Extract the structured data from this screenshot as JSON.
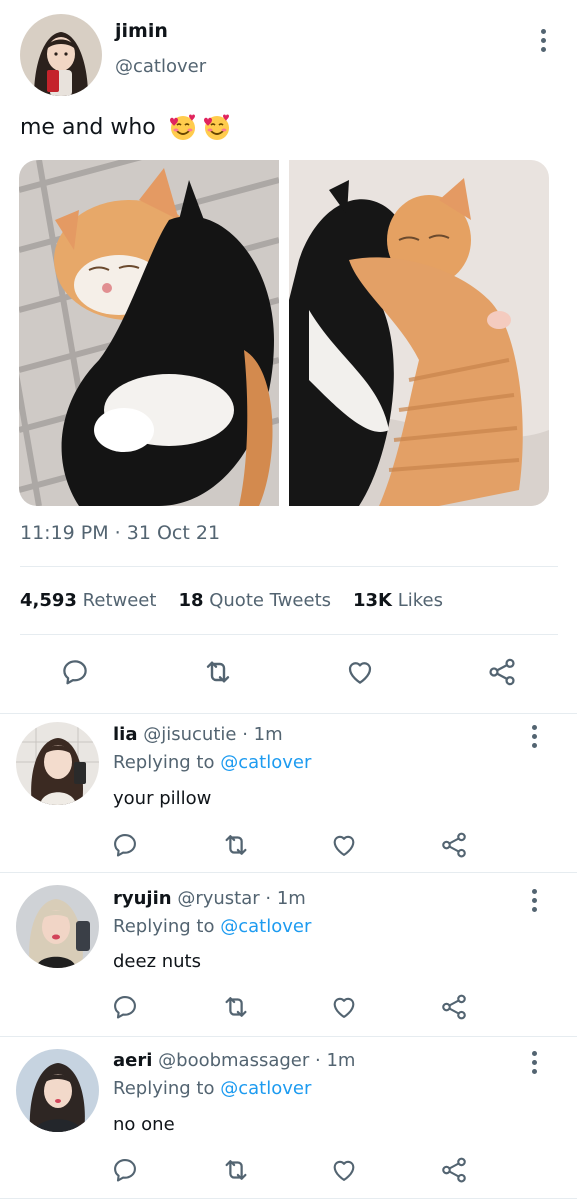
{
  "tweet": {
    "author_name": "jimin",
    "author_handle": "@catlover",
    "text": "me and who",
    "emojis": [
      "smiling-face-with-hearts",
      "smiling-face-with-hearts"
    ],
    "timestamp": "11:19 PM · 31 Oct 21",
    "stats": {
      "retweets_count": "4,593",
      "retweets_label": "Retweet",
      "quotes_count": "18",
      "quotes_label": "Quote Tweets",
      "likes_count": "13K",
      "likes_label": "Likes"
    }
  },
  "actions": {
    "reply_icon": "speech-bubble-icon",
    "retweet_icon": "retweet-icon",
    "like_icon": "heart-icon",
    "share_icon": "share-icon"
  },
  "replies": [
    {
      "name": "lia",
      "handle": "@jisucutie",
      "time": "· 1m",
      "replying_label": "Replying to",
      "replying_to": "@catlover",
      "text": "your pillow"
    },
    {
      "name": "ryujin",
      "handle": "@ryustar",
      "time": "· 1m",
      "replying_label": "Replying to",
      "replying_to": "@catlover",
      "text": "deez nuts"
    },
    {
      "name": "aeri",
      "handle": "@boobmassager",
      "time": "· 1m",
      "replying_label": "Replying to",
      "replying_to": "@catlover",
      "text": "no one"
    }
  ],
  "colors": {
    "link": "#1d9bf0",
    "secondary_text": "#536471",
    "primary_text": "#0f1419",
    "divider": "#e6ecf0"
  }
}
